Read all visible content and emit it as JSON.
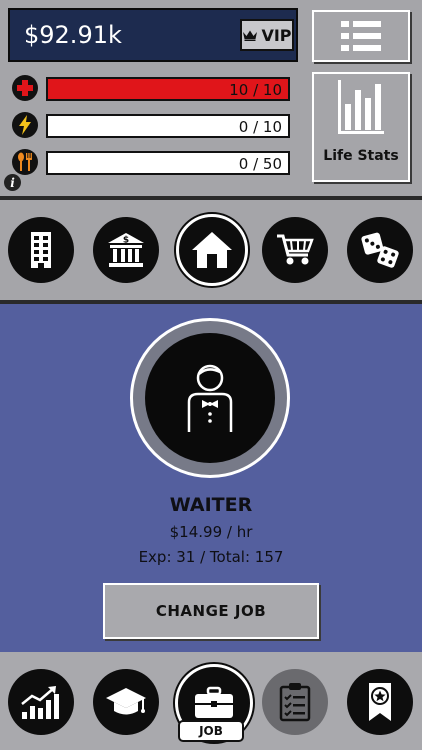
{
  "header": {
    "balance": "$92.91k",
    "vip_label": "VIP",
    "life_stats_label": "Life Stats"
  },
  "stats": [
    {
      "name": "health",
      "icon": "health-cross-icon",
      "value": 10,
      "max": 10,
      "text": "10 / 10",
      "color": "#e0151a"
    },
    {
      "name": "energy",
      "icon": "lightning-icon",
      "value": 0,
      "max": 10,
      "text": "0 / 10",
      "color": "#e0151a"
    },
    {
      "name": "hunger",
      "icon": "fork-spoon-icon",
      "value": 0,
      "max": 50,
      "text": "0 / 50",
      "color": "#e0151a"
    }
  ],
  "categories": [
    {
      "icon": "office-building-icon",
      "selected": false
    },
    {
      "icon": "bank-icon",
      "selected": false
    },
    {
      "icon": "house-icon",
      "selected": true
    },
    {
      "icon": "shopping-cart-icon",
      "selected": false
    },
    {
      "icon": "dice-icon",
      "selected": false
    }
  ],
  "job": {
    "title": "WAITER",
    "pay": "$14.99 / hr",
    "exp": "Exp: 31 / Total: 157",
    "change_label": "CHANGE JOB"
  },
  "bottom_nav": [
    {
      "icon": "growth-chart-icon",
      "state": "normal"
    },
    {
      "icon": "graduation-cap-icon",
      "state": "normal"
    },
    {
      "icon": "briefcase-icon",
      "state": "selected",
      "label": "JOB"
    },
    {
      "icon": "clipboard-checklist-icon",
      "state": "dim"
    },
    {
      "icon": "award-ribbon-icon",
      "state": "normal"
    }
  ],
  "colors": {
    "money_panel": "#1d2b4f",
    "job_area": "#545f9e",
    "panel_gray": "#a5a5a9",
    "bar_red": "#e0151a"
  }
}
